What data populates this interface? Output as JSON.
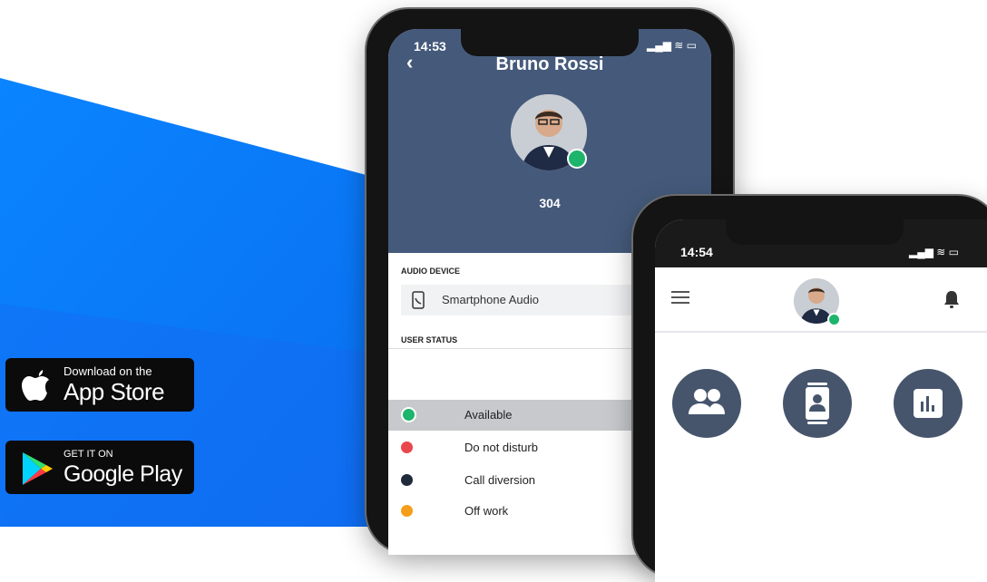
{
  "badges": {
    "apple": {
      "small": "Download on the",
      "big": "App Store"
    },
    "google": {
      "small": "GET IT ON",
      "big": "Google Play"
    }
  },
  "phone1": {
    "time": "14:53",
    "contact_name": "Bruno Rossi",
    "extension": "304",
    "audio_device_header": "AUDIO DEVICE",
    "audio_device_value": "Smartphone Audio",
    "user_status_header": "USER STATUS",
    "statuses": [
      {
        "label": "Available",
        "color": "#1db46b"
      },
      {
        "label": "Do not disturb",
        "color": "#e8474b"
      },
      {
        "label": "Call diversion",
        "color": "#1f2a3a"
      },
      {
        "label": "Off work",
        "color": "#f59e1b"
      }
    ]
  },
  "phone2": {
    "time": "14:54",
    "icons": [
      "people-icon",
      "contacts-icon",
      "stats-icon"
    ]
  },
  "colors": {
    "blue": "#0a84ff",
    "header": "#455a7b",
    "presence": "#1db46b"
  }
}
